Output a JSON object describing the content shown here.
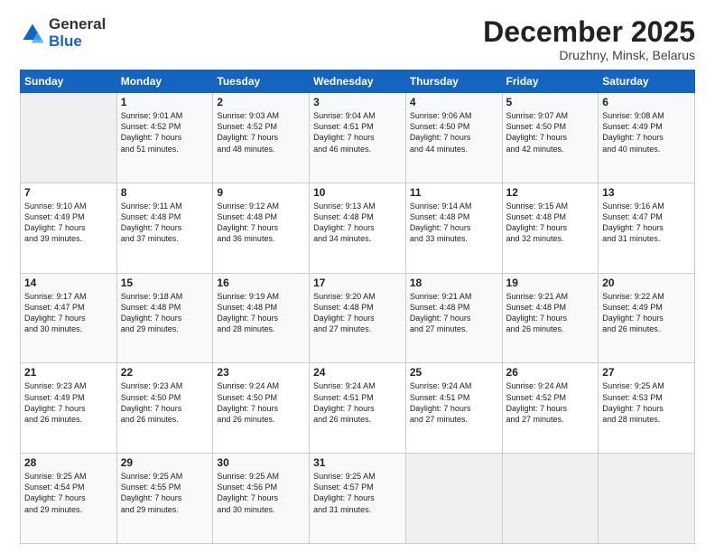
{
  "logo": {
    "general": "General",
    "blue": "Blue"
  },
  "header": {
    "month": "December 2025",
    "location": "Druzhny, Minsk, Belarus"
  },
  "weekdays": [
    "Sunday",
    "Monday",
    "Tuesday",
    "Wednesday",
    "Thursday",
    "Friday",
    "Saturday"
  ],
  "weeks": [
    [
      {
        "day": "",
        "info": ""
      },
      {
        "day": "1",
        "info": "Sunrise: 9:01 AM\nSunset: 4:52 PM\nDaylight: 7 hours\nand 51 minutes."
      },
      {
        "day": "2",
        "info": "Sunrise: 9:03 AM\nSunset: 4:52 PM\nDaylight: 7 hours\nand 48 minutes."
      },
      {
        "day": "3",
        "info": "Sunrise: 9:04 AM\nSunset: 4:51 PM\nDaylight: 7 hours\nand 46 minutes."
      },
      {
        "day": "4",
        "info": "Sunrise: 9:06 AM\nSunset: 4:50 PM\nDaylight: 7 hours\nand 44 minutes."
      },
      {
        "day": "5",
        "info": "Sunrise: 9:07 AM\nSunset: 4:50 PM\nDaylight: 7 hours\nand 42 minutes."
      },
      {
        "day": "6",
        "info": "Sunrise: 9:08 AM\nSunset: 4:49 PM\nDaylight: 7 hours\nand 40 minutes."
      }
    ],
    [
      {
        "day": "7",
        "info": "Sunrise: 9:10 AM\nSunset: 4:49 PM\nDaylight: 7 hours\nand 39 minutes."
      },
      {
        "day": "8",
        "info": "Sunrise: 9:11 AM\nSunset: 4:48 PM\nDaylight: 7 hours\nand 37 minutes."
      },
      {
        "day": "9",
        "info": "Sunrise: 9:12 AM\nSunset: 4:48 PM\nDaylight: 7 hours\nand 36 minutes."
      },
      {
        "day": "10",
        "info": "Sunrise: 9:13 AM\nSunset: 4:48 PM\nDaylight: 7 hours\nand 34 minutes."
      },
      {
        "day": "11",
        "info": "Sunrise: 9:14 AM\nSunset: 4:48 PM\nDaylight: 7 hours\nand 33 minutes."
      },
      {
        "day": "12",
        "info": "Sunrise: 9:15 AM\nSunset: 4:48 PM\nDaylight: 7 hours\nand 32 minutes."
      },
      {
        "day": "13",
        "info": "Sunrise: 9:16 AM\nSunset: 4:47 PM\nDaylight: 7 hours\nand 31 minutes."
      }
    ],
    [
      {
        "day": "14",
        "info": "Sunrise: 9:17 AM\nSunset: 4:47 PM\nDaylight: 7 hours\nand 30 minutes."
      },
      {
        "day": "15",
        "info": "Sunrise: 9:18 AM\nSunset: 4:48 PM\nDaylight: 7 hours\nand 29 minutes."
      },
      {
        "day": "16",
        "info": "Sunrise: 9:19 AM\nSunset: 4:48 PM\nDaylight: 7 hours\nand 28 minutes."
      },
      {
        "day": "17",
        "info": "Sunrise: 9:20 AM\nSunset: 4:48 PM\nDaylight: 7 hours\nand 27 minutes."
      },
      {
        "day": "18",
        "info": "Sunrise: 9:21 AM\nSunset: 4:48 PM\nDaylight: 7 hours\nand 27 minutes."
      },
      {
        "day": "19",
        "info": "Sunrise: 9:21 AM\nSunset: 4:48 PM\nDaylight: 7 hours\nand 26 minutes."
      },
      {
        "day": "20",
        "info": "Sunrise: 9:22 AM\nSunset: 4:49 PM\nDaylight: 7 hours\nand 26 minutes."
      }
    ],
    [
      {
        "day": "21",
        "info": "Sunrise: 9:23 AM\nSunset: 4:49 PM\nDaylight: 7 hours\nand 26 minutes."
      },
      {
        "day": "22",
        "info": "Sunrise: 9:23 AM\nSunset: 4:50 PM\nDaylight: 7 hours\nand 26 minutes."
      },
      {
        "day": "23",
        "info": "Sunrise: 9:24 AM\nSunset: 4:50 PM\nDaylight: 7 hours\nand 26 minutes."
      },
      {
        "day": "24",
        "info": "Sunrise: 9:24 AM\nSunset: 4:51 PM\nDaylight: 7 hours\nand 26 minutes."
      },
      {
        "day": "25",
        "info": "Sunrise: 9:24 AM\nSunset: 4:51 PM\nDaylight: 7 hours\nand 27 minutes."
      },
      {
        "day": "26",
        "info": "Sunrise: 9:24 AM\nSunset: 4:52 PM\nDaylight: 7 hours\nand 27 minutes."
      },
      {
        "day": "27",
        "info": "Sunrise: 9:25 AM\nSunset: 4:53 PM\nDaylight: 7 hours\nand 28 minutes."
      }
    ],
    [
      {
        "day": "28",
        "info": "Sunrise: 9:25 AM\nSunset: 4:54 PM\nDaylight: 7 hours\nand 29 minutes."
      },
      {
        "day": "29",
        "info": "Sunrise: 9:25 AM\nSunset: 4:55 PM\nDaylight: 7 hours\nand 29 minutes."
      },
      {
        "day": "30",
        "info": "Sunrise: 9:25 AM\nSunset: 4:56 PM\nDaylight: 7 hours\nand 30 minutes."
      },
      {
        "day": "31",
        "info": "Sunrise: 9:25 AM\nSunset: 4:57 PM\nDaylight: 7 hours\nand 31 minutes."
      },
      {
        "day": "",
        "info": ""
      },
      {
        "day": "",
        "info": ""
      },
      {
        "day": "",
        "info": ""
      }
    ]
  ]
}
